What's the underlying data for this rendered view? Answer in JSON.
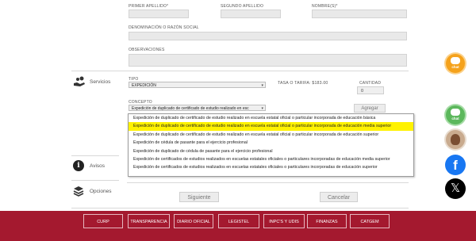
{
  "fields": {
    "primer_apellido": "PRIMER APELLIDO*",
    "segundo_apellido": "SEGUNDO APELLIDO",
    "nombres": "NOMBRE(S)*",
    "denominacion": "DENOMINACIÓN O RAZÓN SOCIAL",
    "observaciones": "OBSERVACIONES"
  },
  "sidebar": {
    "servicios": "Servicios",
    "avisos": "Avisos",
    "opciones": "Opciones"
  },
  "servicios": {
    "tipo_label": "TIPO",
    "tipo_value": "EXPEDICIÓN",
    "tasa": "TASA O TARIFA: $183.00",
    "cantidad_label": "CANTIDAD",
    "cantidad_value": "0",
    "concepto_label": "CONCEPTO",
    "concepto_value": "Expedición de duplicado de certificado de estudio realizado en esc",
    "agregar": "Agregar"
  },
  "dropdown": {
    "options": [
      "Expedición de duplicado de certificado de estudio realizado en escuela estatal oficial o particular incorporada de educación básica",
      "Expedición de duplicado de certificado de estudio realizado en escuela estatal oficial o particular incorporada de educación media superior",
      "Expedición de duplicado de certificado de estudio realizado en escuela estatal oficial o particular incorporada de educación superior",
      "Expedición de cédula de pasante para el ejercicio profesional",
      "Expedición de duplicado de cédula de pasante para el ejercicio profesional",
      "Expedición de certificados de estudios realizados en escuelas estatales oficiales o particulares incorporadas de educación media superior",
      "Expedición de certificados de estudios realizados en escuelas estatales oficiales o particulares incorporadas de educación superior"
    ],
    "selected_index": 1
  },
  "buttons": {
    "siguiente": "Siguiente",
    "cancelar": "Cancelar"
  },
  "footer": {
    "links": [
      "CURP",
      "TRANSPARENCIA",
      "DIARIO OFICIAL",
      "LEGISTEL",
      "INPC'S Y UDIS",
      "FINANZAS",
      "CATGEM"
    ]
  },
  "social": {
    "chat_label_1": "chat",
    "chat_label_2": "chat"
  },
  "colors": {
    "footer": "#a4192f",
    "highlight": "#fff200",
    "chat_orange": "#f5a21c",
    "chat_green": "#5cb85c",
    "facebook": "#1877f2",
    "x": "#000000"
  }
}
